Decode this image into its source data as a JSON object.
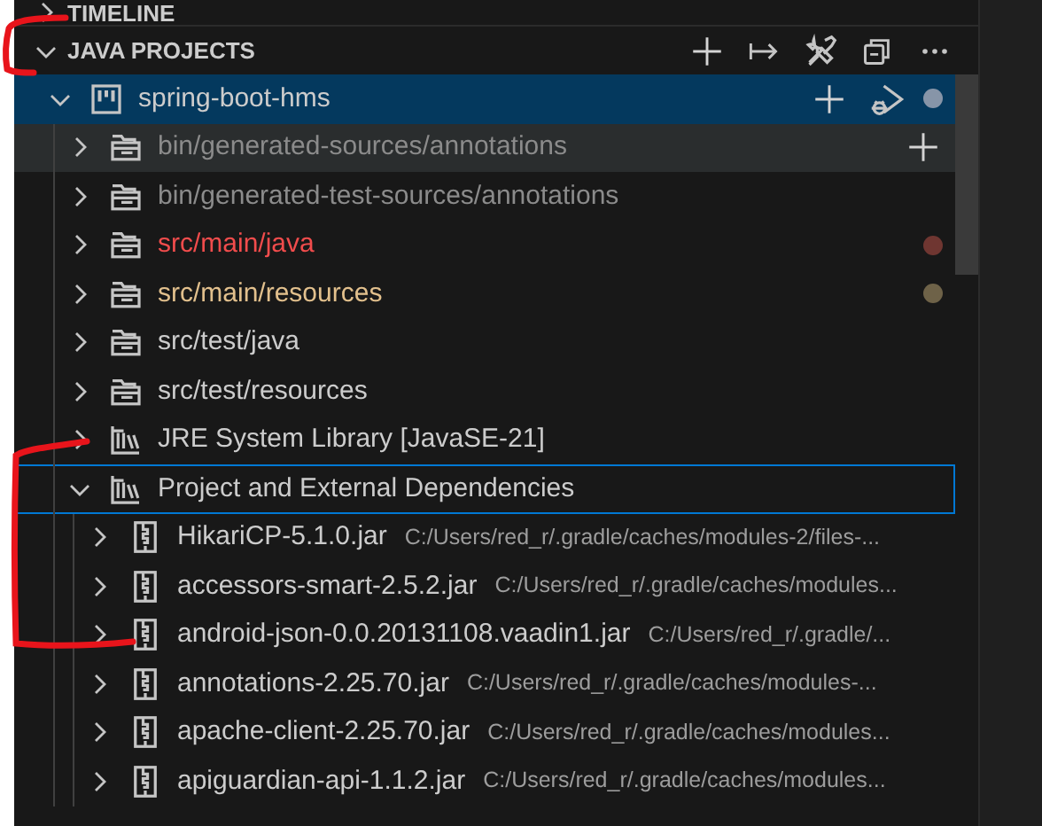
{
  "timeline": {
    "title": "TIMELINE",
    "expanded": false
  },
  "java_projects": {
    "title": "JAVA PROJECTS",
    "expanded": true
  },
  "tree": [
    {
      "kind": "project",
      "label": "spring-boot-hms",
      "expanded": true,
      "selected": true,
      "focused": false,
      "hovered": false,
      "color": "#8795a8",
      "children": [
        {
          "kind": "folder",
          "label": "bin/generated-sources/annotations",
          "expanded": false,
          "selected": false,
          "focused": false,
          "hovered": true,
          "ignored": true,
          "has_errors": false,
          "modified": false
        },
        {
          "kind": "folder",
          "label": "bin/generated-test-sources/annotations",
          "expanded": false,
          "selected": false,
          "focused": false,
          "hovered": false,
          "ignored": true,
          "has_errors": false,
          "modified": false
        },
        {
          "kind": "folder",
          "label": "src/main/java",
          "expanded": false,
          "selected": false,
          "focused": false,
          "hovered": false,
          "ignored": false,
          "has_errors": true,
          "modified": false,
          "color": "#6f3631"
        },
        {
          "kind": "folder",
          "label": "src/main/resources",
          "expanded": false,
          "selected": false,
          "focused": false,
          "hovered": false,
          "ignored": false,
          "has_errors": false,
          "modified": true,
          "color": "#6e6248"
        },
        {
          "kind": "folder",
          "label": "src/test/java",
          "expanded": false,
          "selected": false,
          "focused": false,
          "hovered": false,
          "ignored": false,
          "has_errors": false,
          "modified": false
        },
        {
          "kind": "folder",
          "label": "src/test/resources",
          "expanded": false,
          "selected": false,
          "focused": false,
          "hovered": false,
          "ignored": false,
          "has_errors": false,
          "modified": false
        },
        {
          "kind": "library",
          "label": "JRE System Library [JavaSE-21]",
          "expanded": false,
          "selected": false,
          "focused": false,
          "hovered": false,
          "ignored": false,
          "has_errors": false,
          "modified": false
        },
        {
          "kind": "library",
          "label": "Project and External Dependencies",
          "expanded": true,
          "selected": false,
          "focused": true,
          "hovered": false,
          "ignored": false,
          "has_errors": false,
          "modified": false,
          "children": [
            {
              "kind": "jar",
              "label": "HikariCP-5.1.0.jar",
              "description": "C:/Users/red_r/.gradle/caches/modules-2/files-...",
              "expanded": false,
              "selected": false,
              "focused": false,
              "hovered": false
            },
            {
              "kind": "jar",
              "label": "accessors-smart-2.5.2.jar",
              "description": "C:/Users/red_r/.gradle/caches/modules...",
              "expanded": false,
              "selected": false,
              "focused": false,
              "hovered": false
            },
            {
              "kind": "jar",
              "label": "android-json-0.0.20131108.vaadin1.jar",
              "description": "C:/Users/red_r/.gradle/...",
              "expanded": false,
              "selected": false,
              "focused": false,
              "hovered": false
            },
            {
              "kind": "jar",
              "label": "annotations-2.25.70.jar",
              "description": "C:/Users/red_r/.gradle/caches/modules-...",
              "expanded": false,
              "selected": false,
              "focused": false,
              "hovered": false
            },
            {
              "kind": "jar",
              "label": "apache-client-2.25.70.jar",
              "description": "C:/Users/red_r/.gradle/caches/modules...",
              "expanded": false,
              "selected": false,
              "focused": false,
              "hovered": false
            },
            {
              "kind": "jar",
              "label": "apiguardian-api-1.1.2.jar",
              "description": "C:/Users/red_r/.gradle/caches/modules...",
              "expanded": false,
              "selected": false,
              "focused": false,
              "hovered": false
            }
          ]
        }
      ]
    }
  ]
}
